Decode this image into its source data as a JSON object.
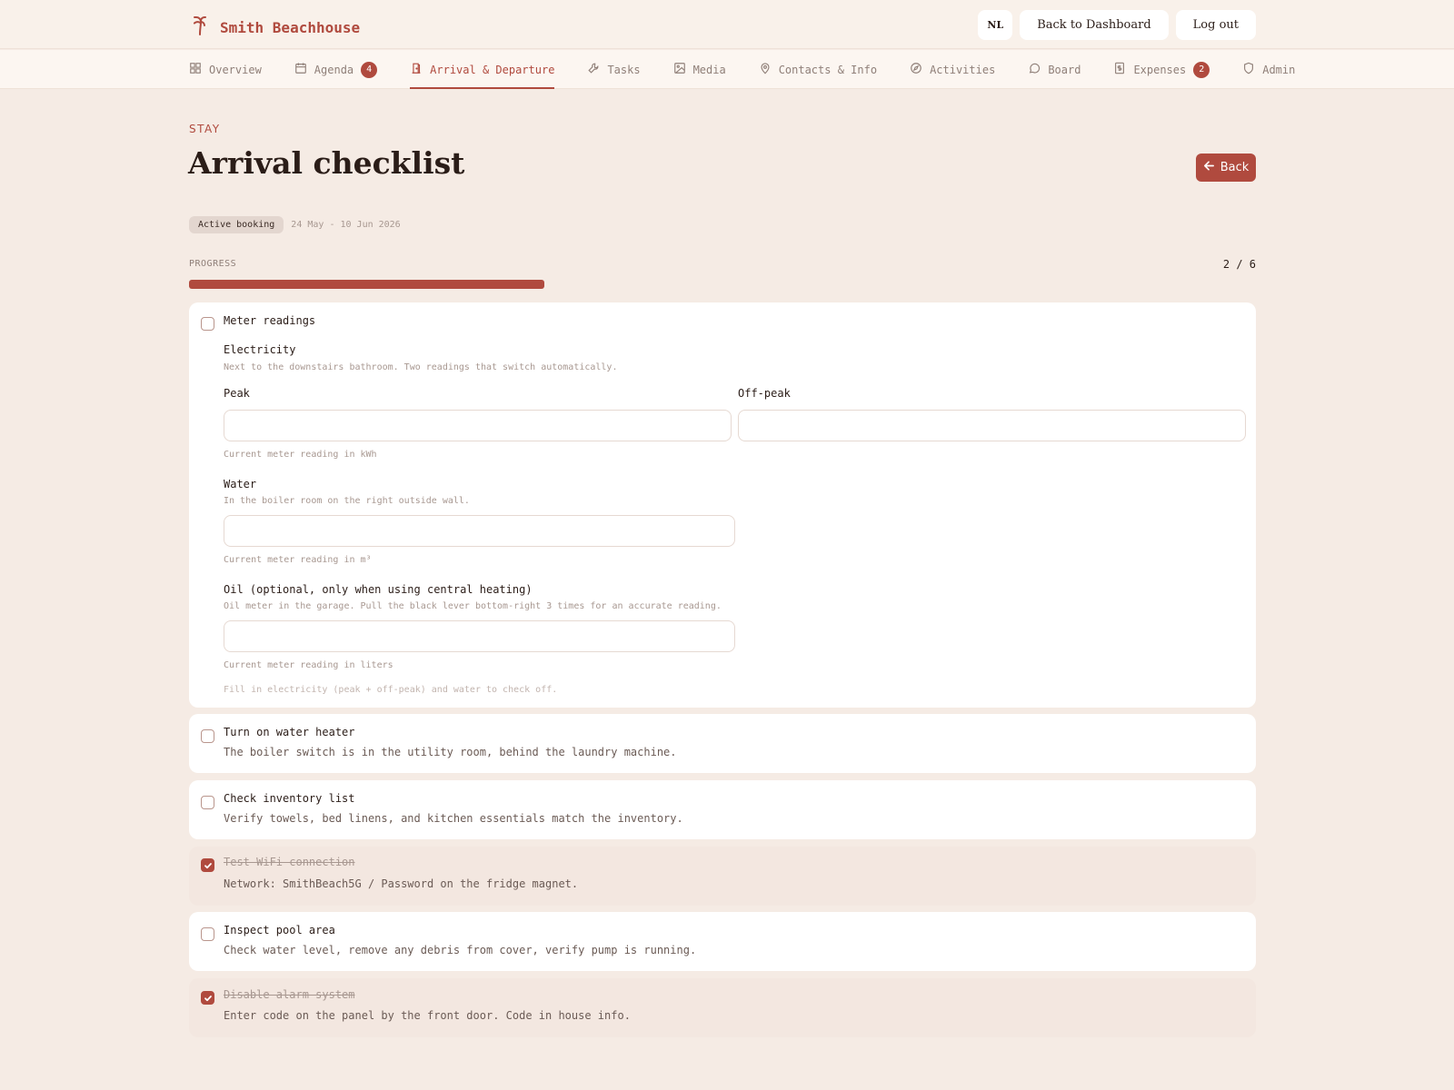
{
  "app": {
    "brand_name": "Smith Beachhouse",
    "lang_label": "NL",
    "back_to_dashboard_label": "Back to Dashboard",
    "logout_label": "Log out",
    "accent_color": "#b04a3e"
  },
  "tabs": [
    {
      "label": "Overview",
      "icon": "grid-icon"
    },
    {
      "label": "Agenda",
      "icon": "calendar-icon",
      "badge": "4"
    },
    {
      "label": "Arrival & Departure",
      "icon": "door-icon",
      "active": true
    },
    {
      "label": "Tasks",
      "icon": "wrench-icon"
    },
    {
      "label": "Media",
      "icon": "image-icon"
    },
    {
      "label": "Contacts & Info",
      "icon": "map-pin-icon"
    },
    {
      "label": "Activities",
      "icon": "compass-icon"
    },
    {
      "label": "Board",
      "icon": "chat-bubble-icon"
    },
    {
      "label": "Expenses",
      "icon": "receipt-icon",
      "badge": "2"
    },
    {
      "label": "Admin",
      "icon": "shield-icon"
    }
  ],
  "page": {
    "eyebrow": "STAY",
    "title": "Arrival checklist",
    "back_label": "Back",
    "booking_badge": "Active booking",
    "booking_dates": "24 May - 10 Jun 2026"
  },
  "progress": {
    "label": "PROGRESS",
    "count_text": "2 / 6",
    "fraction": 0.333
  },
  "meter": {
    "title": "Meter readings",
    "checked": false,
    "electricity": {
      "title": "Electricity",
      "hint": "Next to the downstairs bathroom. Two readings that switch automatically.",
      "peak_label": "Peak",
      "peak_value": "",
      "offpeak_label": "Off-peak",
      "offpeak_value": "",
      "unit_hint": "Current meter reading in kWh"
    },
    "water": {
      "title": "Water",
      "hint": "In the boiler room on the right outside wall.",
      "value": "",
      "unit_hint": "Current meter reading in m³"
    },
    "oil": {
      "title": "Oil (optional, only when using central heating)",
      "hint": "Oil meter in the garage. Pull the black lever bottom-right 3 times for an accurate reading.",
      "value": "",
      "unit_hint": "Current meter reading in liters"
    },
    "footnote": "Fill in electricity (peak + off-peak) and water to check off."
  },
  "items": [
    {
      "title": "Turn on water heater",
      "description": "The boiler switch is in the utility room, behind the laundry machine.",
      "checked": false
    },
    {
      "title": "Check inventory list",
      "description": "Verify towels, bed linens, and kitchen essentials match the inventory.",
      "checked": false
    },
    {
      "title": "Test WiFi connection",
      "description": "Network: SmithBeach5G / Password on the fridge magnet.",
      "checked": true
    },
    {
      "title": "Inspect pool area",
      "description": "Check water level, remove any debris from cover, verify pump is running.",
      "checked": false
    },
    {
      "title": "Disable alarm system",
      "description": "Enter code on the panel by the front door. Code in house info.",
      "checked": true
    }
  ]
}
